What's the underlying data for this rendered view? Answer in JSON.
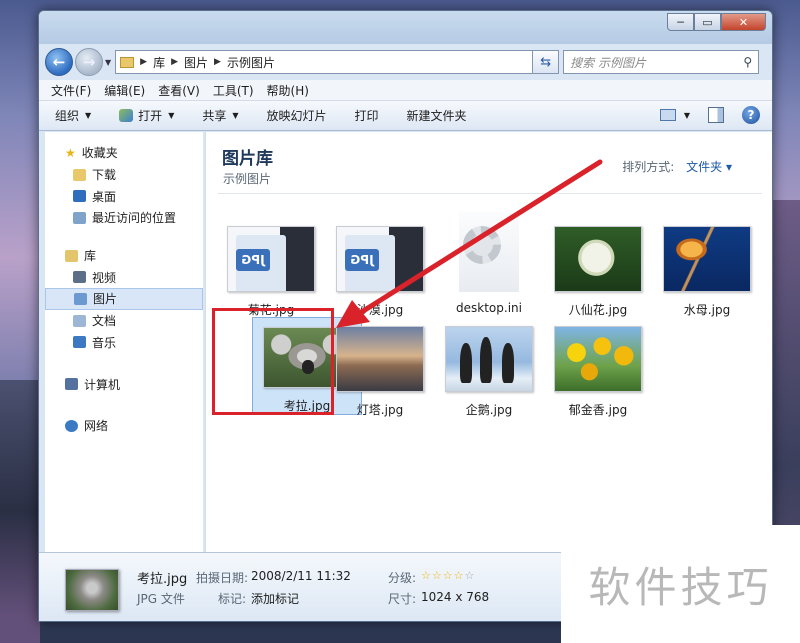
{
  "window": {
    "caption": {
      "minimize": "─",
      "maximize": "▭",
      "close": "✕"
    }
  },
  "address": {
    "crumbs": [
      "库",
      "图片",
      "示例图片"
    ],
    "search_placeholder": "搜索 示例图片"
  },
  "menu": [
    "文件(F)",
    "编辑(E)",
    "查看(V)",
    "工具(T)",
    "帮助(H)"
  ],
  "toolbar": {
    "organize": "组织",
    "open": "打开",
    "share": "共享",
    "slideshow": "放映幻灯片",
    "print": "打印",
    "new_folder": "新建文件夹",
    "help": "?"
  },
  "nav": {
    "favorites": {
      "label": "收藏夹",
      "items": [
        "下载",
        "桌面",
        "最近访问的位置"
      ]
    },
    "libraries": {
      "label": "库",
      "items": [
        "视频",
        "图片",
        "文档",
        "音乐"
      ],
      "selected": "图片"
    },
    "computer": "计算机",
    "network": "网络"
  },
  "content": {
    "title": "图片库",
    "subtitle": "示例图片",
    "arrange_label": "排列方式:",
    "arrange_value": "文件夹"
  },
  "files": [
    {
      "name": "菊花.jpg",
      "thumb": "jpg-icon"
    },
    {
      "name": "沙漠.jpg",
      "thumb": "jpg-icon"
    },
    {
      "name": "desktop.ini",
      "thumb": "settings-file-icon"
    },
    {
      "name": "八仙花.jpg",
      "thumb": "hydrangea-photo"
    },
    {
      "name": "水母.jpg",
      "thumb": "jellyfish-photo"
    },
    {
      "name": "考拉.jpg",
      "thumb": "koala-photo",
      "selected": true
    },
    {
      "name": "灯塔.jpg",
      "thumb": "lighthouse-photo"
    },
    {
      "name": "企鹅.jpg",
      "thumb": "penguins-photo"
    },
    {
      "name": "郁金香.jpg",
      "thumb": "tulips-photo"
    }
  ],
  "details": {
    "filename": "考拉.jpg",
    "date_label": "拍摄日期:",
    "date_value": "2008/2/11 11:32",
    "type": "JPG 文件",
    "tags_label": "标记:",
    "tags_value": "添加标记",
    "rating_label": "分级:",
    "rating_value": 0,
    "size_label": "尺寸:",
    "size_value": "1024 x 768"
  },
  "watermark": "软件技巧",
  "colors": {
    "highlight": "#d9222a",
    "accent": "#1e5aa6"
  }
}
